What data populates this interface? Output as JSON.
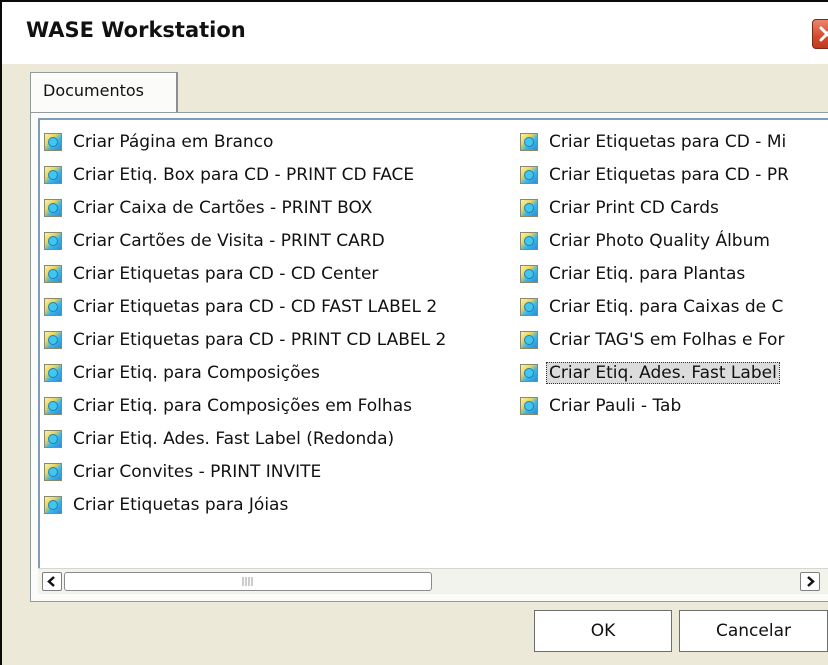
{
  "window": {
    "title": "WASE Workstation"
  },
  "tabs": [
    {
      "label": "Documentos",
      "active": true
    }
  ],
  "list": {
    "column1": [
      "Criar Página em Branco",
      "Criar Etiq. Box para CD - PRINT CD FACE",
      "Criar Caixa de Cartões - PRINT BOX",
      "Criar Cartões de Visita - PRINT CARD",
      "Criar Etiquetas para CD - CD Center",
      "Criar Etiquetas para CD - CD FAST LABEL 2",
      "Criar Etiquetas para CD - PRINT CD LABEL 2",
      "Criar Etiq. para Composições",
      "Criar Etiq. para Composições em Folhas",
      "Criar Etiq. Ades. Fast Label (Redonda)",
      "Criar Convites - PRINT INVITE",
      "Criar Etiquetas para Jóias"
    ],
    "column2": [
      "Criar Etiquetas para CD - Mi",
      "Criar Etiquetas para CD - PR",
      "Criar Print CD Cards",
      "Criar Photo Quality Álbum",
      "Criar Etiq. para Plantas",
      "Criar Etiq. para Caixas de C",
      "Criar TAG'S em Folhas e For",
      "Criar Etiq. Ades. Fast Label",
      "Criar Pauli - Tab"
    ],
    "selected_item": "Criar Etiq. Ades. Fast Label"
  },
  "buttons": {
    "ok": "OK",
    "cancel": "Cancelar"
  },
  "icons": {
    "close": "close-icon",
    "document": "document-template-icon",
    "scroll_left": "arrow-left-icon",
    "scroll_right": "arrow-right-icon"
  },
  "colors": {
    "close_button": "#d5492b",
    "listbox_border": "#7f9db9",
    "dialog_bg": "#ece9d8"
  }
}
